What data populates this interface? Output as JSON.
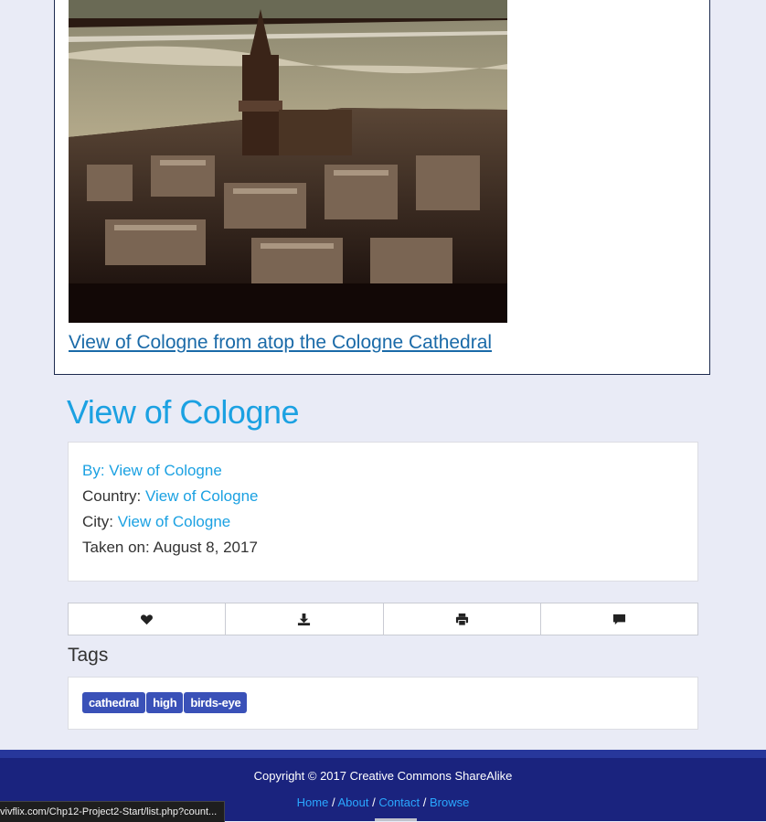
{
  "photo": {
    "image_alt": "Aerial photo of Cologne with church tower and river",
    "caption": "View of Cologne from atop the Cologne Cathedral"
  },
  "details": {
    "title": "View of Cologne",
    "by_label": "By:",
    "by_value": "View of Cologne",
    "country_label": "Country:",
    "country_value": "View of Cologne",
    "city_label": "City:",
    "city_value": "View of Cologne",
    "taken_label": "Taken on:",
    "taken_value": "August 8, 2017"
  },
  "actions": [
    {
      "icon": "heart-icon"
    },
    {
      "icon": "download-icon"
    },
    {
      "icon": "print-icon"
    },
    {
      "icon": "comment-icon"
    }
  ],
  "tags": {
    "heading": "Tags",
    "items": [
      "cathedral",
      "high",
      "birds-eye"
    ]
  },
  "footer": {
    "copyright": "Copyright © 2017 Creative Commons ShareAlike",
    "links": [
      "Home",
      "About",
      "Contact",
      "Browse"
    ],
    "separator": "/"
  },
  "status_bar": {
    "url": "vivflix.com/Chp12-Project2-Start/list.php?count..."
  },
  "colors": {
    "accent": "#1ba1e2",
    "tag_bg": "#3a51b8",
    "footer_bg": "#1a237e"
  }
}
